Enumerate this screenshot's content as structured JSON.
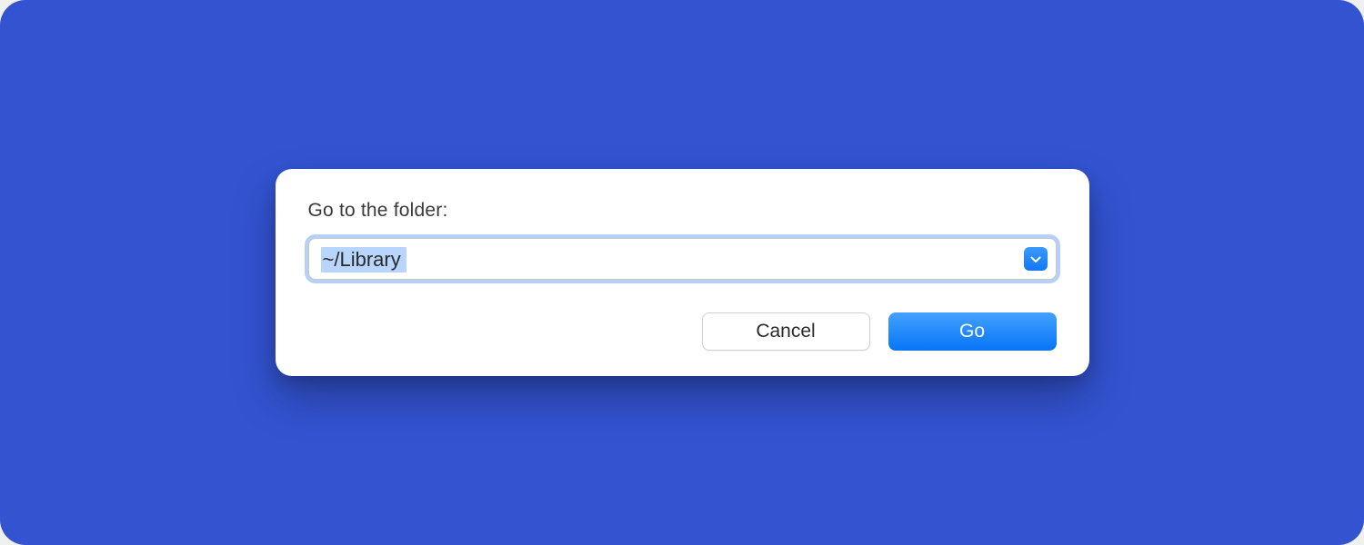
{
  "dialog": {
    "label": "Go to the folder:",
    "path_value": "~/Library",
    "buttons": {
      "cancel": "Cancel",
      "go": "Go"
    }
  },
  "colors": {
    "backdrop": "#3353d1",
    "accent": "#1277f3",
    "focus_ring": "#b7d0f6",
    "selection": "#b7d5fd"
  }
}
